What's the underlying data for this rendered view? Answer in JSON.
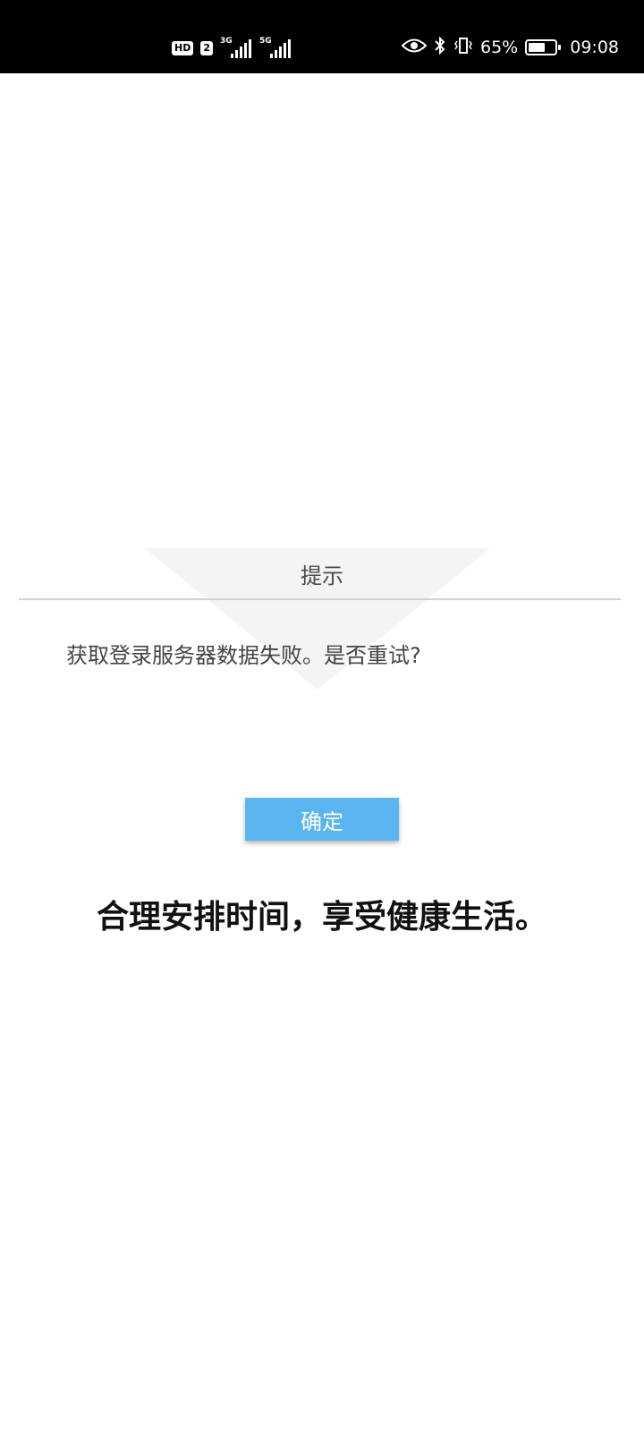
{
  "status_bar": {
    "hd_label": "HD",
    "sim_label": "2",
    "sig1_tech": "3G",
    "sig2_tech": "5G",
    "battery_text": "65%",
    "battery_level": 0.65,
    "time": "09:08",
    "icons": [
      "eye-icon",
      "bluetooth-icon",
      "vibrate-icon",
      "battery-icon"
    ]
  },
  "dialog": {
    "title": "提示",
    "message": "获取登录服务器数据失败。是否重试?",
    "confirm_label": "确定",
    "accent_color": "#5ab4f0"
  },
  "slogan": "合理安排时间，享受健康生活。"
}
